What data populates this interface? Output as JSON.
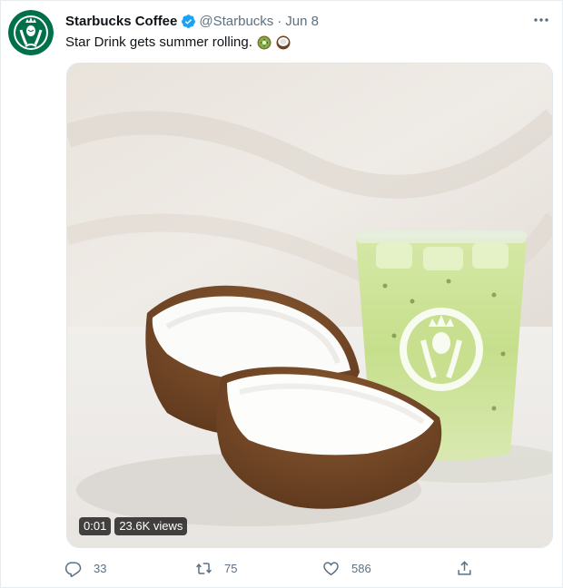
{
  "tweet": {
    "author_name": "Starbucks Coffee",
    "handle": "@Starbucks",
    "separator": "·",
    "date": "Jun 8",
    "text": "Star Drink gets summer rolling.",
    "emojis": [
      "kiwi-emoji",
      "coconut-emoji"
    ]
  },
  "media": {
    "timestamp": "0:01",
    "views": "23.6K views"
  },
  "actions": {
    "replies": "33",
    "retweets": "75",
    "likes": "586"
  },
  "colors": {
    "brand_green": "#00704a",
    "secondary_text": "#5b7083",
    "verified_blue": "#1da1f2"
  }
}
